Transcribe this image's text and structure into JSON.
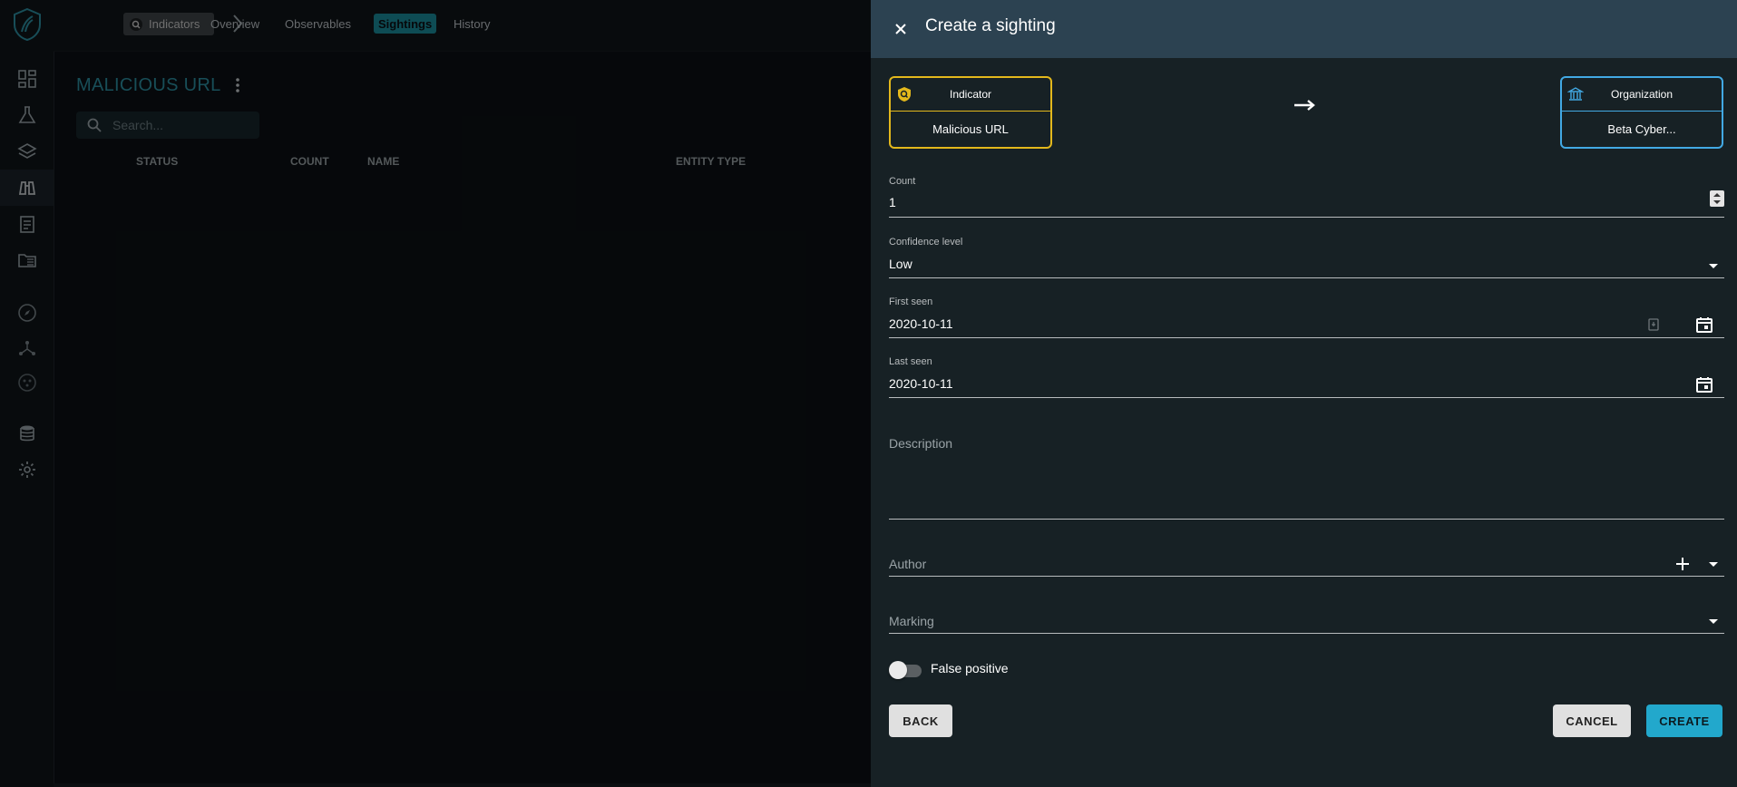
{
  "topbar": {
    "chip_label": "Indicators",
    "tabs": [
      "Overview",
      "Observables",
      "Sightings",
      "History"
    ],
    "active_tab": "Sightings"
  },
  "page": {
    "title": "MALICIOUS URL",
    "search_placeholder": "Search...",
    "columns": [
      "STATUS",
      "COUNT",
      "NAME",
      "ENTITY TYPE"
    ]
  },
  "nav_icons": [
    "dashboard-icon",
    "flask-icon",
    "layers-icon",
    "binoculars-icon",
    "clipboard-icon",
    "folder-table-icon",
    "compass-icon",
    "graph-icon",
    "connections-icon",
    "database-icon",
    "gear-icon"
  ],
  "drawer": {
    "title": "Create a sighting",
    "from_card": {
      "type": "Indicator",
      "name": "Malicious URL",
      "color": "#e3b81c"
    },
    "to_card": {
      "type": "Organization",
      "name": "Beta Cyber...",
      "color": "#42a9e4"
    },
    "count": {
      "label": "Count",
      "value": "1"
    },
    "confidence": {
      "label": "Confidence level",
      "value": "Low"
    },
    "first_seen": {
      "label": "First seen",
      "value": "2020-10-11"
    },
    "last_seen": {
      "label": "Last seen",
      "value": "2020-10-11"
    },
    "description": {
      "placeholder": "Description"
    },
    "author": {
      "placeholder": "Author"
    },
    "marking": {
      "placeholder": "Marking"
    },
    "false_positive": {
      "label": "False positive",
      "checked": false
    },
    "buttons": {
      "back": "BACK",
      "cancel": "CANCEL",
      "create": "CREATE"
    }
  },
  "colors": {
    "accent": "#22a8cc",
    "header": "#2c4251",
    "drawer_bg": "#172125"
  }
}
